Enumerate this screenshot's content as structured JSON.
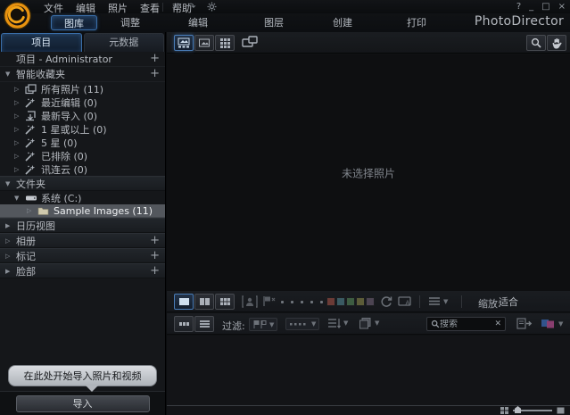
{
  "window": {
    "app_title": "PhotoDirector",
    "controls": [
      "?",
      "_",
      "□",
      "×"
    ]
  },
  "menu_bar": {
    "items": [
      "文件",
      "编辑",
      "照片",
      "查看",
      "帮助"
    ]
  },
  "mode_tabs": [
    {
      "label": "图库",
      "active": true
    },
    {
      "label": "调整",
      "active": false
    },
    {
      "label": "编辑",
      "active": false
    },
    {
      "label": "图层",
      "active": false
    },
    {
      "label": "创建",
      "active": false
    },
    {
      "label": "打印",
      "active": false
    }
  ],
  "left_panel": {
    "tabs": [
      {
        "label": "项目",
        "active": true
      },
      {
        "label": "元数据",
        "active": false
      }
    ],
    "rows": [
      {
        "type": "header",
        "label": "项目 - Administrator",
        "add": true
      },
      {
        "type": "header",
        "arrow": "▼",
        "label": "智能收藏夹",
        "add": true
      },
      {
        "type": "tree",
        "arrow": "▷",
        "icon": "photos",
        "label": "所有照片 (11)",
        "indent": 1
      },
      {
        "type": "tree",
        "arrow": "▷",
        "icon": "wand",
        "label": "最近编辑 (0)",
        "indent": 1
      },
      {
        "type": "tree",
        "arrow": "▷",
        "icon": "import",
        "label": "最新导入 (0)",
        "indent": 1
      },
      {
        "type": "tree",
        "arrow": "▷",
        "icon": "wand",
        "label": "1 星或以上 (0)",
        "indent": 1
      },
      {
        "type": "tree",
        "arrow": "▷",
        "icon": "wand",
        "label": "5 星 (0)",
        "indent": 1
      },
      {
        "type": "tree",
        "arrow": "▷",
        "icon": "wand",
        "label": "已排除 (0)",
        "indent": 1
      },
      {
        "type": "tree",
        "arrow": "▷",
        "icon": "wand",
        "label": "讯连云 (0)",
        "indent": 1
      },
      {
        "type": "section",
        "arrow": "▼",
        "label": "文件夹"
      },
      {
        "type": "tree",
        "arrow": "▼",
        "icon": "drive",
        "label": "系统 (C:)",
        "indent": 1
      },
      {
        "type": "tree",
        "arrow": "▷",
        "icon": "folder",
        "label": "Sample Images (11)",
        "indent": 2,
        "selected": true
      },
      {
        "type": "section",
        "arrow": "▶",
        "label": "日历视图"
      },
      {
        "type": "section",
        "arrow": "▷",
        "label": "相册",
        "add": true
      },
      {
        "type": "section",
        "arrow": "▷",
        "label": "标记",
        "add": true
      },
      {
        "type": "section",
        "arrow": "▶",
        "label": "脸部",
        "add": true
      }
    ],
    "tooltip": "在此处开始导入照片和视频",
    "import_button": "导入"
  },
  "viewer": {
    "empty_text": "未选择照片",
    "zoom_label": "缩放:",
    "zoom_value": "适合"
  },
  "browser_bar": {
    "filter_label": "过滤:",
    "search_placeholder": "搜索"
  },
  "colors": {
    "accent_blue": "#3f74b5",
    "label_colors": [
      "#6b3b36",
      "#3a5a62",
      "#3d5c41",
      "#5c5c38",
      "#4c4452"
    ]
  }
}
